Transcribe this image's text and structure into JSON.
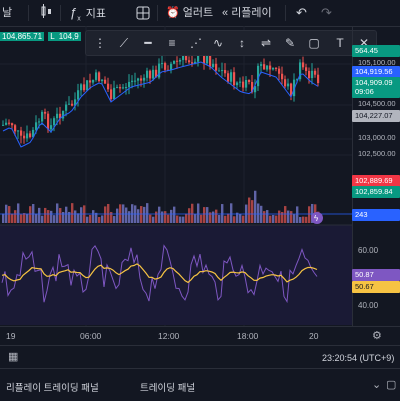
{
  "toolbar": {
    "left_fragment": "날",
    "indicators_label": "지표",
    "alerts_label": "얼러트",
    "replay_label": "리플레이"
  },
  "legend": {
    "price_a": "104,865.71",
    "price_b_prefix": "L",
    "price_b": "104,9"
  },
  "drawing_tools": [
    "cursor-icon",
    "trendline-icon",
    "hline-icon",
    "fib-icon",
    "pattern-icon",
    "abc-icon",
    "projection-icon",
    "brush-icon",
    "rect-icon",
    "text-icon",
    "close-icon"
  ],
  "price_scale": {
    "labels": [
      {
        "text": "105,100.00"
      },
      {
        "text": "104,500.00"
      },
      {
        "text": "103,000.00"
      },
      {
        "text": "102,500.00"
      }
    ],
    "badges": {
      "top_partial": "564.45",
      "current_price": "104,919.56",
      "ema_price": "104,909.09",
      "countdown": "09:06",
      "sma_price": "104,227.07",
      "red_level": "102,889.69",
      "green_level": "102,859.84",
      "volume": "243"
    }
  },
  "oscillator": {
    "labels": [
      "60.00",
      "40.00"
    ],
    "value_a": "50.87",
    "value_b": "50.67"
  },
  "time_axis": [
    "19",
    "06:00",
    "12:00",
    "18:00",
    "20"
  ],
  "status": {
    "clock": "23:20:54",
    "timezone": "(UTC+9)"
  },
  "bottom_tabs": [
    "리플레이 트레이딩 패널",
    "트레이딩 패널"
  ],
  "colors": {
    "up": "#26a69a",
    "down": "#ef5350",
    "volume_up": "#7b7fd4",
    "volume_down": "#d9534f",
    "ema": "#2962ff",
    "osc_line": "#7e57c2",
    "osc_signal": "#f6c343",
    "badge_blue": "#2962ff",
    "badge_green": "#089981",
    "badge_red": "#f23645"
  }
}
